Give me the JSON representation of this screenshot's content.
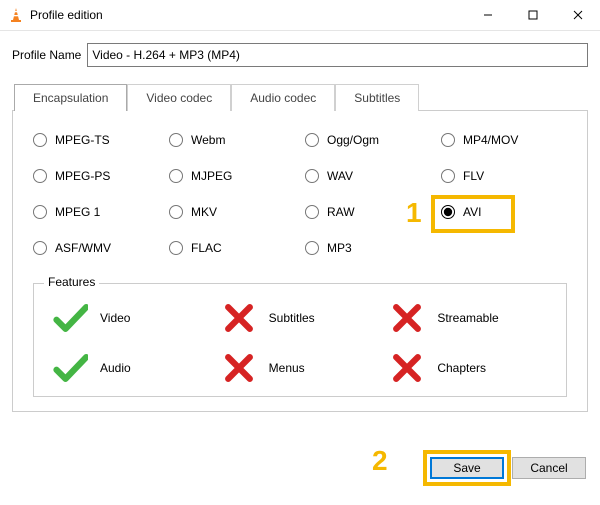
{
  "window": {
    "title": "Profile edition",
    "icon": "vlc-cone-icon"
  },
  "profile": {
    "label": "Profile Name",
    "value": "Video - H.264 + MP3 (MP4)"
  },
  "tabs": [
    {
      "id": "encapsulation",
      "label": "Encapsulation",
      "active": true
    },
    {
      "id": "video_codec",
      "label": "Video codec",
      "active": false
    },
    {
      "id": "audio_codec",
      "label": "Audio codec",
      "active": false
    },
    {
      "id": "subtitles",
      "label": "Subtitles",
      "active": false
    }
  ],
  "encapsulation": {
    "formats": [
      {
        "id": "mpeg_ts",
        "label": "MPEG-TS",
        "selected": false
      },
      {
        "id": "webm",
        "label": "Webm",
        "selected": false
      },
      {
        "id": "ogg",
        "label": "Ogg/Ogm",
        "selected": false
      },
      {
        "id": "mp4",
        "label": "MP4/MOV",
        "selected": false
      },
      {
        "id": "mpeg_ps",
        "label": "MPEG-PS",
        "selected": false
      },
      {
        "id": "mjpeg",
        "label": "MJPEG",
        "selected": false
      },
      {
        "id": "wav",
        "label": "WAV",
        "selected": false
      },
      {
        "id": "flv",
        "label": "FLV",
        "selected": false
      },
      {
        "id": "mpeg1",
        "label": "MPEG 1",
        "selected": false
      },
      {
        "id": "mkv",
        "label": "MKV",
        "selected": false
      },
      {
        "id": "raw",
        "label": "RAW",
        "selected": false
      },
      {
        "id": "avi",
        "label": "AVI",
        "selected": true
      },
      {
        "id": "asf",
        "label": "ASF/WMV",
        "selected": false
      },
      {
        "id": "flac",
        "label": "FLAC",
        "selected": false
      },
      {
        "id": "mp3",
        "label": "MP3",
        "selected": false
      }
    ],
    "features": {
      "legend": "Features",
      "items": [
        {
          "id": "video",
          "label": "Video",
          "supported": true
        },
        {
          "id": "subtitles",
          "label": "Subtitles",
          "supported": false
        },
        {
          "id": "streamable",
          "label": "Streamable",
          "supported": false
        },
        {
          "id": "audio",
          "label": "Audio",
          "supported": true
        },
        {
          "id": "menus",
          "label": "Menus",
          "supported": false
        },
        {
          "id": "chapters",
          "label": "Chapters",
          "supported": false
        }
      ]
    }
  },
  "callouts": {
    "one": "1",
    "two": "2"
  },
  "buttons": {
    "save": "Save",
    "cancel": "Cancel"
  }
}
